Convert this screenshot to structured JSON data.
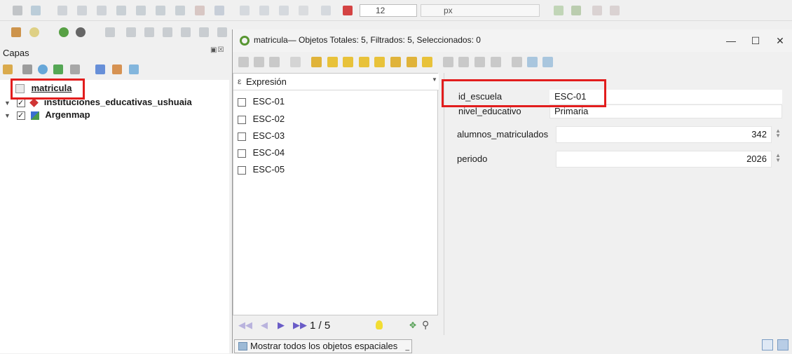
{
  "toolbar": {
    "font_size_value": "12",
    "unit_value": "px"
  },
  "layers": {
    "title": "Capas",
    "items": [
      {
        "name": "matricula",
        "checked": false,
        "type": "table"
      },
      {
        "name": "instituciones_educativas_ushuaia",
        "checked": true,
        "type": "point"
      },
      {
        "name": "Argenmap",
        "checked": true,
        "type": "raster"
      }
    ]
  },
  "dialog": {
    "title": "matricula— Objetos Totales: 5, Filtrados: 5, Seleccionados: 0",
    "minimize": "—",
    "maximize": "☐",
    "close": "✕",
    "expression_label": "Expresión",
    "features": [
      "ESC-01",
      "ESC-02",
      "ESC-03",
      "ESC-04",
      "ESC-05"
    ],
    "page_indicator": "1 / 5",
    "show_all_label": "Mostrar todos los objetos espaciales",
    "form": [
      {
        "label": "id_escuela",
        "value": "ESC-01"
      },
      {
        "label": "nivel_educativo",
        "value": "Primaria"
      },
      {
        "label": "alumnos_matriculados",
        "value": "342"
      },
      {
        "label": "periodo",
        "value": "2026"
      }
    ]
  },
  "colors": {
    "highlight": "#e21d1d",
    "qgis_green": "#589632"
  }
}
